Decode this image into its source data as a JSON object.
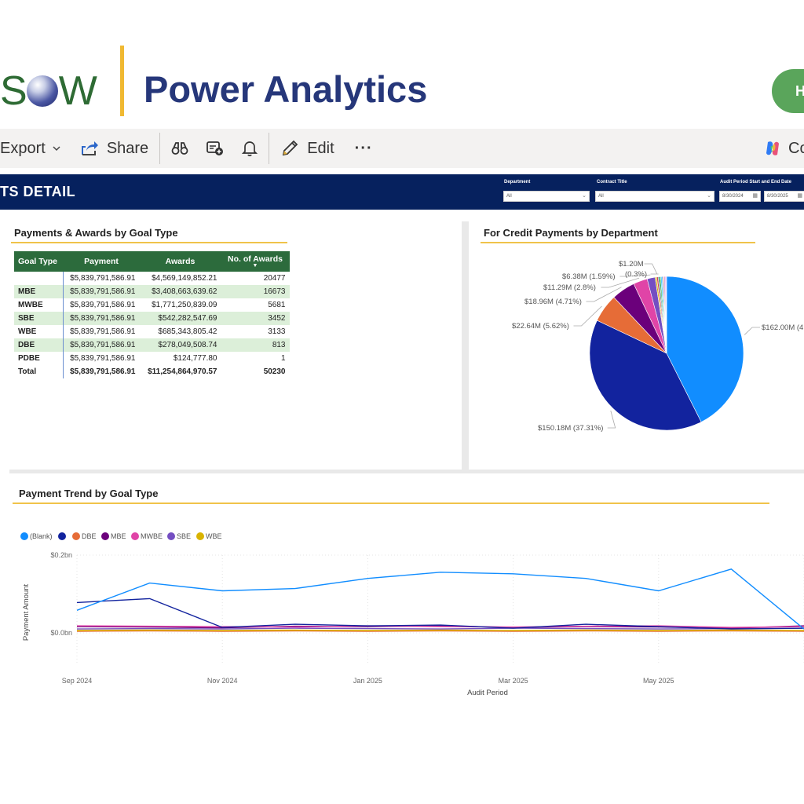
{
  "header": {
    "logo_left": "S",
    "logo_right": "W",
    "app_title": "Power Analytics",
    "help_button": "H"
  },
  "toolbar": {
    "items": [
      "Export",
      "Share",
      "Edit",
      "···",
      "Co"
    ]
  },
  "banner": {
    "title": "TS DETAIL",
    "slicers": {
      "department_label": "Department",
      "department_value": "All",
      "contract_label": "Contract Title",
      "contract_value": "All",
      "period_label": "Audit Period Start and End Date",
      "period_start": "8/30/2024",
      "period_end": "8/30/2025"
    }
  },
  "table": {
    "title": "Payments & Awards by Goal Type",
    "headers": [
      "Goal Type",
      "Payment",
      "Awards",
      "No. of Awards"
    ],
    "rows": [
      [
        "",
        "$5,839,791,586.91",
        "$4,569,149,852.21",
        "20477"
      ],
      [
        "MBE",
        "$5,839,791,586.91",
        "$3,408,663,639.62",
        "16673"
      ],
      [
        "MWBE",
        "$5,839,791,586.91",
        "$1,771,250,839.09",
        "5681"
      ],
      [
        "SBE",
        "$5,839,791,586.91",
        "$542,282,547.69",
        "3452"
      ],
      [
        "WBE",
        "$5,839,791,586.91",
        "$685,343,805.42",
        "3133"
      ],
      [
        "DBE",
        "$5,839,791,586.91",
        "$278,049,508.74",
        "813"
      ],
      [
        "PDBE",
        "$5,839,791,586.91",
        "$124,777.80",
        "1"
      ],
      [
        "Total",
        "$5,839,791,586.91",
        "$11,254,864,970.57",
        "50230"
      ]
    ]
  },
  "pie": {
    "title": "For Credit Payments by Department"
  },
  "trend": {
    "title": "Payment Trend by Goal Type"
  },
  "chart_data": [
    {
      "type": "pie",
      "title": "For Credit Payments by Department",
      "values": [
        162.0,
        150.18,
        22.64,
        18.96,
        11.29,
        6.38,
        1.2,
        1.2,
        1.0,
        1.0,
        0.9,
        0.9,
        0.8,
        0.8,
        0.7,
        0.6
      ],
      "labels": [
        "$162.00M (4",
        "$150.18M (37.31%)",
        "$22.64M (5.62%)",
        "$18.96M (4.71%)",
        "$11.29M (2.8%)",
        "$6.38M (1.59%)",
        "(0.3%)",
        "$1.20M",
        "",
        "",
        "",
        "",
        "",
        "",
        "",
        ""
      ],
      "colors": [
        "#118dff",
        "#12239e",
        "#e66c37",
        "#6b007b",
        "#e044a7",
        "#744ec2",
        "#d9b300",
        "#d64550",
        "#197278",
        "#1aab40",
        "#15c6f4",
        "#4092ff",
        "#ffa058",
        "#be5dc9",
        "#f472d0",
        "#b5a1ff"
      ]
    },
    {
      "type": "line",
      "title": "Payment Trend by Goal Type",
      "xlabel": "Audit Period",
      "ylabel": "Payment Amount",
      "x": [
        "2024-09",
        "2024-10",
        "2024-11",
        "2024-12",
        "2025-01",
        "2025-02",
        "2025-03",
        "2025-04",
        "2025-05",
        "2025-06",
        "2025-07"
      ],
      "x_tick_labels": [
        "Sep 2024",
        "Nov 2024",
        "Jan 2025",
        "Mar 2025",
        "May 2025"
      ],
      "y_tick_labels": [
        "$0.2bn",
        "$0.0bn"
      ],
      "ylim": [
        0,
        0.2
      ],
      "legend": [
        "(Blank)",
        "",
        "DBE",
        "MBE",
        "MWBE",
        "SBE",
        "WBE"
      ],
      "legend_position": "top-left",
      "series": [
        {
          "name": "(Blank)",
          "color": "#118dff",
          "values": [
            0.058,
            0.128,
            0.108,
            0.114,
            0.14,
            0.156,
            0.152,
            0.14,
            0.108,
            0.164,
            0.01
          ]
        },
        {
          "name": "",
          "color": "#12239e",
          "values": [
            0.078,
            0.088,
            0.014,
            0.022,
            0.018,
            0.02,
            0.012,
            0.022,
            0.016,
            0.01,
            0.012
          ]
        },
        {
          "name": "DBE",
          "color": "#e66c37",
          "values": [
            0.004,
            0.005,
            0.004,
            0.005,
            0.004,
            0.005,
            0.004,
            0.005,
            0.004,
            0.005,
            0.004
          ]
        },
        {
          "name": "MBE",
          "color": "#6b007b",
          "values": [
            0.016,
            0.015,
            0.013,
            0.017,
            0.016,
            0.018,
            0.014,
            0.016,
            0.015,
            0.012,
            0.018
          ]
        },
        {
          "name": "MWBE",
          "color": "#e044a7",
          "values": [
            0.018,
            0.017,
            0.016,
            0.015,
            0.018,
            0.016,
            0.015,
            0.017,
            0.018,
            0.014,
            0.016
          ]
        },
        {
          "name": "SBE",
          "color": "#744ec2",
          "values": [
            0.01,
            0.011,
            0.01,
            0.012,
            0.011,
            0.01,
            0.012,
            0.011,
            0.01,
            0.011,
            0.012
          ]
        },
        {
          "name": "WBE",
          "color": "#d9b300",
          "values": [
            0.006,
            0.007,
            0.006,
            0.007,
            0.006,
            0.007,
            0.006,
            0.007,
            0.006,
            0.007,
            0.006
          ]
        }
      ]
    }
  ]
}
